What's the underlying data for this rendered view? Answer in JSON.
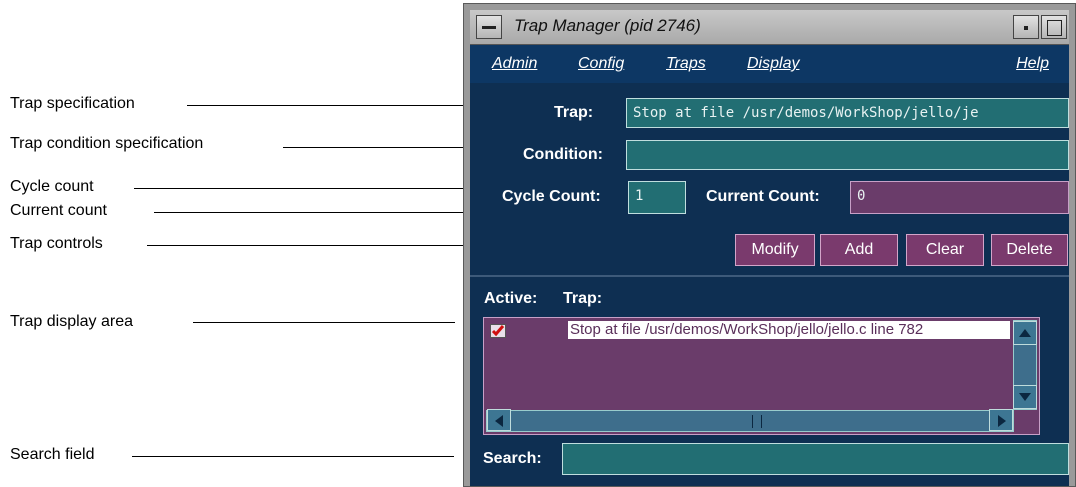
{
  "callouts": {
    "trap_spec": "Trap specification",
    "trap_condition": "Trap condition specification",
    "cycle_count": "Cycle count",
    "current_count": "Current count",
    "trap_controls": "Trap controls",
    "trap_display": "Trap display area",
    "search_field": "Search field"
  },
  "window": {
    "title": "Trap Manager (pid 2746)"
  },
  "menu": {
    "admin": "Admin",
    "config": "Config",
    "traps": "Traps",
    "display": "Display",
    "help": "Help"
  },
  "form": {
    "trap_label": "Trap:",
    "trap_value": "Stop at file /usr/demos/WorkShop/jello/je",
    "condition_label": "Condition:",
    "condition_value": "",
    "cycle_label": "Cycle Count:",
    "cycle_value": "1",
    "current_label": "Current Count:",
    "current_value": "0"
  },
  "buttons": {
    "modify": "Modify",
    "add": "Add",
    "clear": "Clear",
    "delete": "Delete"
  },
  "list": {
    "header_active": "Active:",
    "header_trap": "Trap:",
    "rows": [
      {
        "active": true,
        "trap": "Stop at file /usr/demos/WorkShop/jello/jello.c line 782"
      }
    ]
  },
  "search": {
    "label": "Search:",
    "value": ""
  },
  "icons": {
    "window_menu": "window-menu-icon",
    "minimize": "minimize-icon",
    "maximize": "maximize-icon",
    "checkbox": "checkbox-checked-icon"
  },
  "colors": {
    "window_bg": "#0e2f52",
    "text_field": "#226e73",
    "count_field": "#6a3c6a",
    "button": "#7a3a6d"
  }
}
